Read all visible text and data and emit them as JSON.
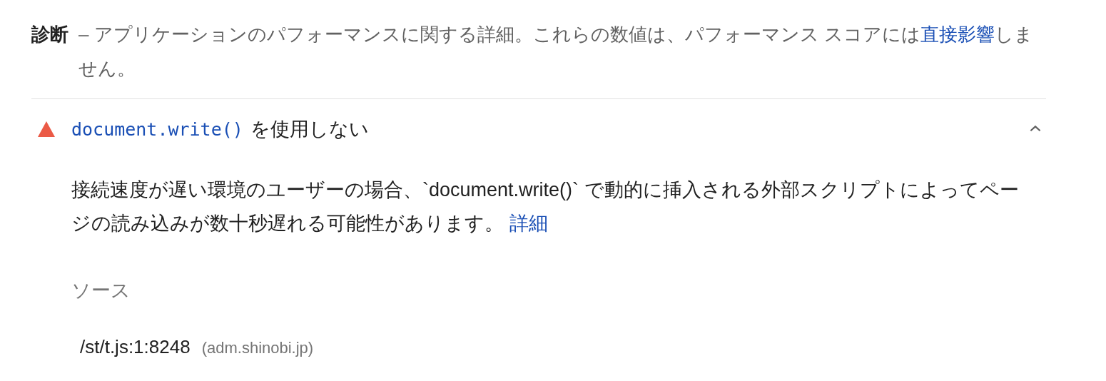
{
  "section": {
    "title": "診断",
    "description": "– アプリケーションのパフォーマンスに関する詳細。これらの数値は、パフォーマンス スコアには",
    "link": "直接影響",
    "after": "しません。"
  },
  "audit": {
    "failed": true,
    "code": "document.write()",
    "title": "を使用しない",
    "expanded": true,
    "description": "接続速度が遅い環境のユーザーの場合、`document.write()` で動的に挿入される外部スクリプトによってページの読み込みが数十秒遅れる可能性があります。",
    "link": "詳細",
    "sources_label": "ソース",
    "sources": [
      {
        "url": "/st/t.js:1:8248",
        "host": "(adm.shinobi.jp)"
      }
    ]
  }
}
